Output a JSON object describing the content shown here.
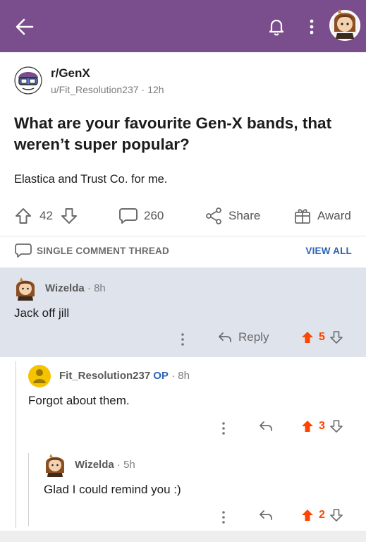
{
  "topbar": {
    "back_icon": "back-arrow-icon",
    "bell_icon": "bell-icon",
    "more_icon": "more-vertical-icon",
    "avatar": "user-avatar",
    "color": "#7a4d8c"
  },
  "post": {
    "subreddit": "r/GenX",
    "author": "u/Fit_Resolution237",
    "age": "12h",
    "title": "What are your favourite Gen-X bands, that weren’t super popular?",
    "body": "Elastica and Trust Co. for me.",
    "upvotes": "42",
    "comments": "260",
    "share_label": "Share",
    "award_label": "Award"
  },
  "thread_bar": {
    "label": "SINGLE COMMENT THREAD",
    "view_all": "VIEW ALL"
  },
  "comments": [
    {
      "author": "Wizelda",
      "age": "8h",
      "op": "",
      "text": "Jack off jill",
      "reply_label": "Reply",
      "score": "5",
      "highlighted": true
    },
    {
      "author": "Fit_Resolution237",
      "age": "8h",
      "op": "OP",
      "text": "Forgot about them.",
      "reply_label": "",
      "score": "3",
      "highlighted": false
    },
    {
      "author": "Wizelda",
      "age": "5h",
      "op": "",
      "text": "Glad I could remind you :)",
      "reply_label": "",
      "score": "2",
      "highlighted": false
    }
  ],
  "colors": {
    "accent": "#ff4500",
    "link": "#2b63b6",
    "highlight": "#dfe3ec"
  },
  "separator": "·"
}
